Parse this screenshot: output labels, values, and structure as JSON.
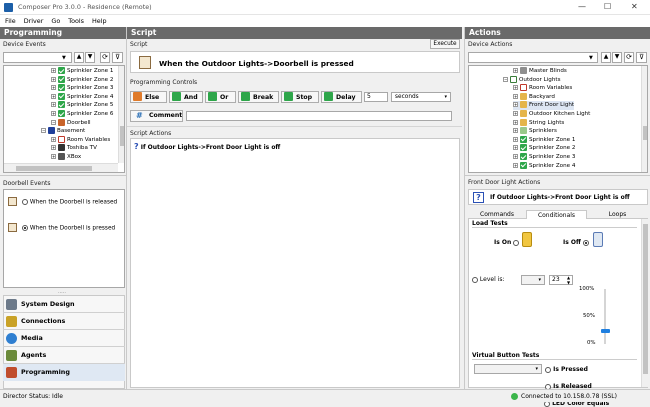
{
  "window": {
    "title": "Composer Pro 3.0.0 - Residence (Remote)",
    "minimize": "—",
    "maximize": "☐",
    "close": "✕"
  },
  "menu": [
    "File",
    "Driver",
    "Go",
    "Tools",
    "Help"
  ],
  "programming": {
    "header": "Programming",
    "device_events_label": "Device Events",
    "tree": [
      {
        "label": "Sprinkler Zone 1",
        "icon": "checkmark-icon"
      },
      {
        "label": "Sprinkler Zone 2",
        "icon": "checkmark-icon"
      },
      {
        "label": "Sprinkler Zone 3",
        "icon": "checkmark-icon"
      },
      {
        "label": "Sprinkler Zone 4",
        "icon": "checkmark-icon"
      },
      {
        "label": "Sprinkler Zone 5",
        "icon": "checkmark-icon"
      },
      {
        "label": "Sprinkler Zone 6",
        "icon": "checkmark-icon"
      },
      {
        "label": "Doorbell",
        "icon": "doorbell-icon"
      },
      {
        "label": "Basement",
        "icon": "room-icon"
      },
      {
        "label": "Room Variables",
        "icon": "variables-icon"
      },
      {
        "label": "Toshiba TV",
        "icon": "tv-icon"
      },
      {
        "label": "XBox",
        "icon": "xbox-icon"
      }
    ],
    "doorbell_events_label": "Doorbell Events",
    "events": [
      {
        "label": "When the Doorbell is released",
        "selected": false
      },
      {
        "label": "When the Doorbell is pressed",
        "selected": true
      }
    ],
    "nav": [
      {
        "label": "System Design",
        "color": "#6d7a8a"
      },
      {
        "label": "Connections",
        "color": "#c9a227"
      },
      {
        "label": "Media",
        "color": "#2f7fd1"
      },
      {
        "label": "Agents",
        "color": "#6a8a3a"
      },
      {
        "label": "Programming",
        "color": "#c04d2d"
      }
    ]
  },
  "script": {
    "header": "Script",
    "script_label": "Script",
    "execute": "Execute",
    "event_text": "When the Outdoor Lights->Doorbell is pressed",
    "controls_label": "Programming Controls",
    "controls": {
      "else": "Else",
      "and": "And",
      "or": "Or",
      "break": "Break",
      "stop": "Stop",
      "delay": "Delay",
      "delay_value": "5",
      "delay_unit": "seconds",
      "comment": "Comment"
    },
    "actions_label": "Script Actions",
    "actions": [
      "If Outdoor Lights->Front Door Light is off"
    ]
  },
  "actions": {
    "header": "Actions",
    "device_actions_label": "Device Actions",
    "tree": [
      {
        "label": "Master Blinds",
        "icon": "blinds-icon"
      },
      {
        "label": "Outdoor Lights",
        "icon": "room-icon"
      },
      {
        "label": "Room Variables",
        "icon": "variables-icon"
      },
      {
        "label": "Backyard",
        "icon": "light-icon"
      },
      {
        "label": "Front Door Light",
        "icon": "light-icon"
      },
      {
        "label": "Outdoor Kitchen Light",
        "icon": "light-icon"
      },
      {
        "label": "String Lights",
        "icon": "light-icon"
      },
      {
        "label": "Sprinklers",
        "icon": "sprinklers-icon"
      },
      {
        "label": "Sprinkler Zone 1",
        "icon": "checkmark-icon"
      },
      {
        "label": "Sprinkler Zone 2",
        "icon": "checkmark-icon"
      },
      {
        "label": "Sprinkler Zone 3",
        "icon": "checkmark-icon"
      },
      {
        "label": "Sprinkler Zone 4",
        "icon": "checkmark-icon"
      }
    ],
    "device_label": "Front Door Light Actions",
    "selected_text": "If Outdoor Lights->Front Door Light is off",
    "tabs": [
      "Commands",
      "Conditionals",
      "Loops"
    ],
    "active_tab": "Conditionals",
    "load_tests": "Load Tests",
    "is_on": "Is On",
    "is_off": "Is Off",
    "level_is": "Level is:",
    "level_value": "23",
    "level_marks": [
      "100%",
      "50%",
      "0%"
    ],
    "level_fraction": 0.23,
    "virtual_tests": "Virtual Button Tests",
    "is_pressed": "Is Pressed",
    "is_released": "Is Released",
    "led_color": "LED Color Equals"
  },
  "status": {
    "left": "Director Status: Idle",
    "right": "Connected to 10.158.0.78 (SSL)"
  }
}
